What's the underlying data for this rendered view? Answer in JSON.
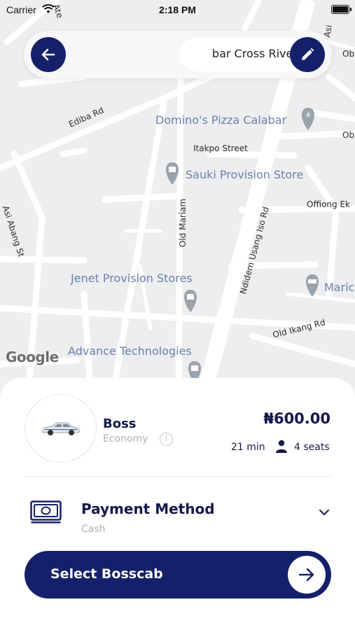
{
  "status_bar": {
    "carrier": "Carrier",
    "time": "2:18 PM"
  },
  "search": {
    "destination_text": "bar Cross River N",
    "back_icon": "arrow-left-icon",
    "edit_icon": "pencil-icon"
  },
  "map": {
    "provider": "Google",
    "pois": [
      "Domino's Pizza Calabar",
      "Sauki Provision Store",
      "Jenet Provision Stores",
      "Advance Technologies",
      "Maric"
    ],
    "streets": [
      "Ediba Rd",
      "Itakpo Street",
      "Offiong Ek",
      "Asi Abang St",
      "Old Mariam",
      "Ndidem Usang Iso Rd",
      "Old Ikang Rd",
      "Ob",
      "Ob",
      "Ate",
      "Asi"
    ]
  },
  "ride": {
    "name": "Boss",
    "class": "Economy",
    "price": "₦600.00",
    "eta": "21 min",
    "seats": "4 seats"
  },
  "payment": {
    "title": "Payment Method",
    "value": "Cash"
  },
  "action": {
    "select_label": "Select Bosscab"
  },
  "colors": {
    "primary": "#15206a",
    "text_dark": "#15194a",
    "muted": "#b0b0b0",
    "map_bg": "#eceef0",
    "poi_text": "#6d7fab"
  }
}
